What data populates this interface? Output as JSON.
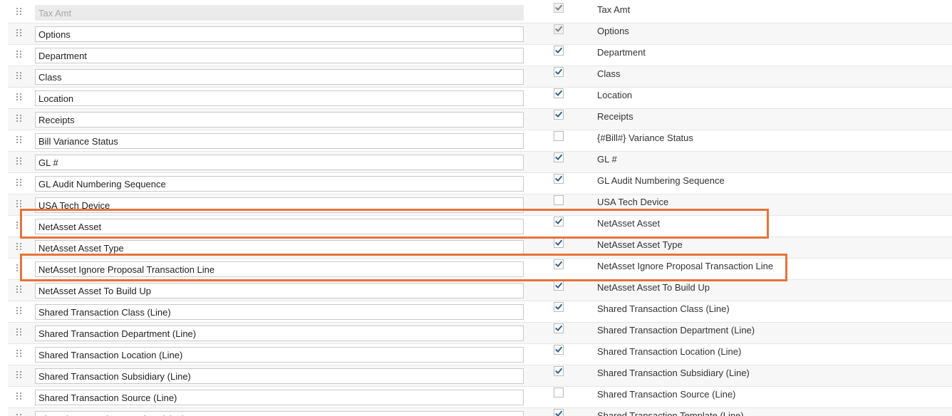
{
  "colors": {
    "highlight_border": "#e8723a",
    "checkmark": "#2e5e8f",
    "checkmark_disabled": "#7e7e7e",
    "input_border": "#c9c9c9",
    "row_shaded": "#f7f7f7"
  },
  "icons": {
    "drag_handle": "drag-handle-icon",
    "checkbox_check": "checkmark-icon"
  },
  "rows": [
    {
      "label": "Tax Amt",
      "label_disabled": true,
      "checked": true,
      "check_disabled": true,
      "field": "Tax Amt"
    },
    {
      "label": "Options",
      "label_disabled": false,
      "checked": true,
      "check_disabled": true,
      "field": "Options"
    },
    {
      "label": "Department",
      "label_disabled": false,
      "checked": true,
      "check_disabled": false,
      "field": "Department"
    },
    {
      "label": "Class",
      "label_disabled": false,
      "checked": true,
      "check_disabled": false,
      "field": "Class"
    },
    {
      "label": "Location",
      "label_disabled": false,
      "checked": true,
      "check_disabled": false,
      "field": "Location"
    },
    {
      "label": "Receipts",
      "label_disabled": false,
      "checked": true,
      "check_disabled": false,
      "field": "Receipts"
    },
    {
      "label": "Bill Variance Status",
      "label_disabled": false,
      "checked": false,
      "check_disabled": false,
      "field": "{#Bill#} Variance Status"
    },
    {
      "label": "GL #",
      "label_disabled": false,
      "checked": true,
      "check_disabled": false,
      "field": "GL #"
    },
    {
      "label": "GL Audit Numbering Sequence",
      "label_disabled": false,
      "checked": true,
      "check_disabled": false,
      "field": "GL Audit Numbering Sequence"
    },
    {
      "label": "USA Tech Device",
      "label_disabled": false,
      "checked": false,
      "check_disabled": false,
      "field": "USA Tech Device"
    },
    {
      "label": "NetAsset Asset",
      "label_disabled": false,
      "checked": true,
      "check_disabled": false,
      "field": "NetAsset Asset"
    },
    {
      "label": "NetAsset Asset Type",
      "label_disabled": false,
      "checked": true,
      "check_disabled": false,
      "field": "NetAsset Asset Type"
    },
    {
      "label": "NetAsset Ignore Proposal Transaction Line",
      "label_disabled": false,
      "checked": true,
      "check_disabled": false,
      "field": "NetAsset Ignore Proposal Transaction Line"
    },
    {
      "label": "NetAsset Asset To Build Up",
      "label_disabled": false,
      "checked": true,
      "check_disabled": false,
      "field": "NetAsset Asset To Build Up"
    },
    {
      "label": "Shared Transaction Class (Line)",
      "label_disabled": false,
      "checked": true,
      "check_disabled": false,
      "field": "Shared Transaction Class (Line)"
    },
    {
      "label": "Shared Transaction Department (Line)",
      "label_disabled": false,
      "checked": true,
      "check_disabled": false,
      "field": "Shared Transaction Department (Line)"
    },
    {
      "label": "Shared Transaction Location (Line)",
      "label_disabled": false,
      "checked": true,
      "check_disabled": false,
      "field": "Shared Transaction Location (Line)"
    },
    {
      "label": "Shared Transaction Subsidiary (Line)",
      "label_disabled": false,
      "checked": true,
      "check_disabled": false,
      "field": "Shared Transaction Subsidiary (Line)"
    },
    {
      "label": "Shared Transaction Source (Line)",
      "label_disabled": false,
      "checked": false,
      "check_disabled": false,
      "field": "Shared Transaction Source (Line)"
    },
    {
      "label": "Shared Transaction Template (Line)",
      "label_disabled": false,
      "checked": true,
      "check_disabled": false,
      "field": "Shared Transaction Template (Line)"
    }
  ]
}
